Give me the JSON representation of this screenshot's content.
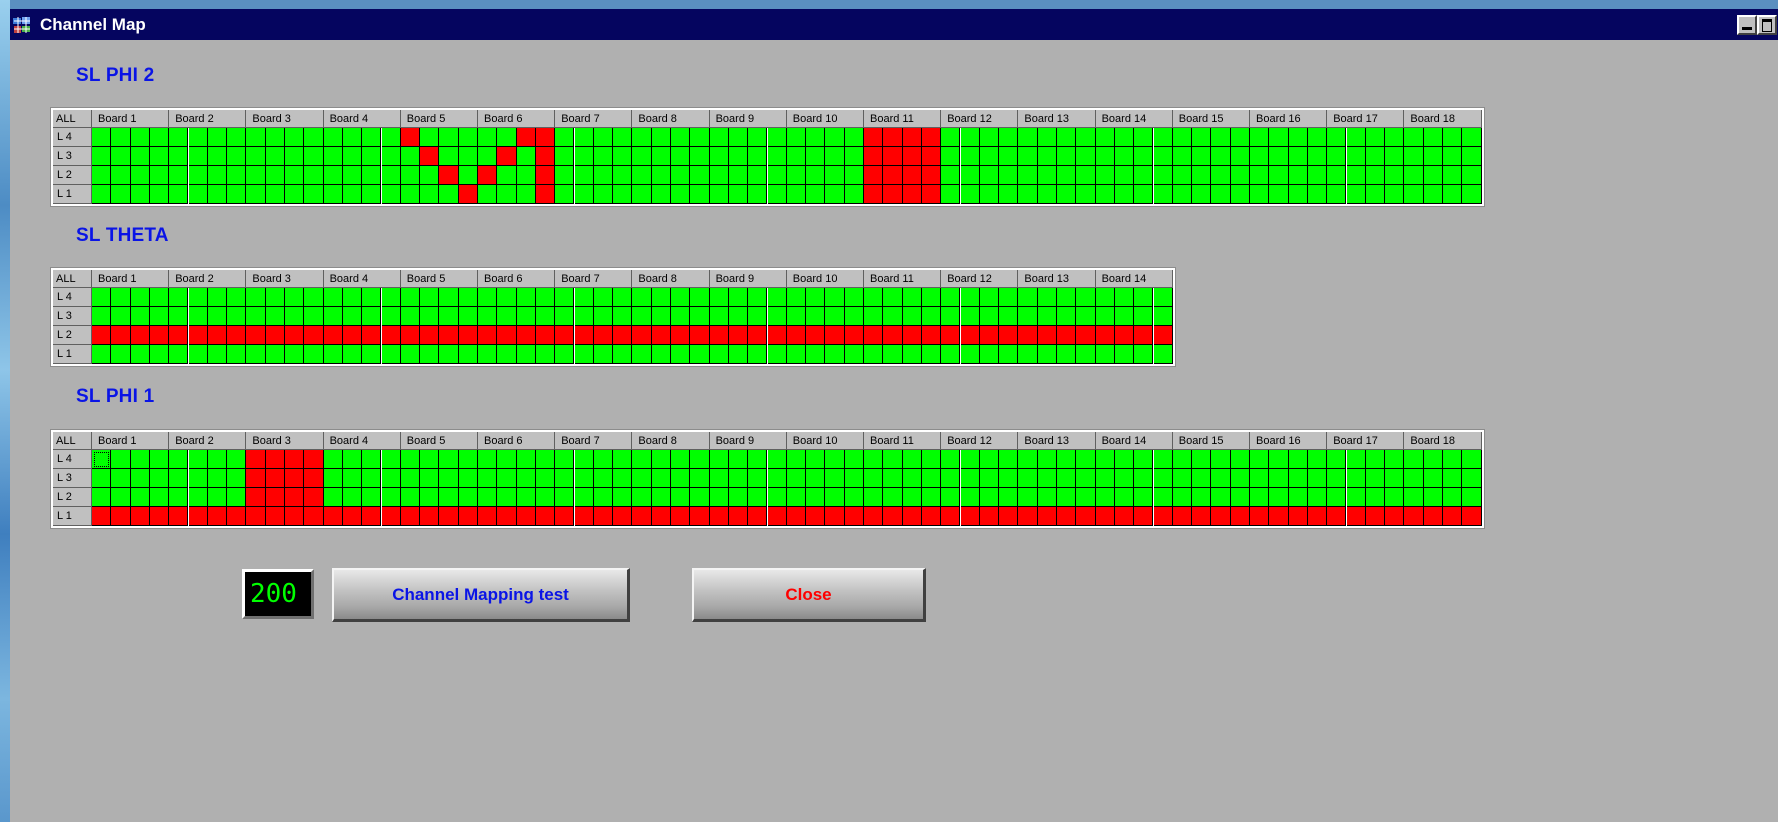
{
  "window": {
    "title": "Channel Map"
  },
  "colors": {
    "ok": "#00ff00",
    "bad": "#ff0000",
    "title_text": "#0a14e6"
  },
  "header": {
    "all_label": "ALL"
  },
  "layers": [
    "L 4",
    "L 3",
    "L 2",
    "L 1"
  ],
  "sections": [
    {
      "id": "phi2",
      "title": "SL PHI 2",
      "boards": [
        "Board 1",
        "Board 2",
        "Board 3",
        "Board 4",
        "Board 5",
        "Board 6",
        "Board 7",
        "Board 8",
        "Board 9",
        "Board 10",
        "Board 11",
        "Board 12",
        "Board 13",
        "Board 14",
        "Board 15",
        "Board 16",
        "Board 17",
        "Board 18"
      ],
      "channels_per_board": 4,
      "dead_channels": {
        "L 4": [
          16,
          22,
          23,
          40,
          41,
          42,
          43
        ],
        "L 3": [
          17,
          21,
          23,
          40,
          41,
          42,
          43
        ],
        "L 2": [
          18,
          20,
          23,
          40,
          41,
          42,
          43
        ],
        "L 1": [
          19,
          23,
          40,
          41,
          42,
          43
        ]
      },
      "dead_layers": []
    },
    {
      "id": "theta",
      "title": "SL THETA",
      "boards": [
        "Board 1",
        "Board 2",
        "Board 3",
        "Board 4",
        "Board 5",
        "Board 6",
        "Board 7",
        "Board 8",
        "Board 9",
        "Board 10",
        "Board 11",
        "Board 12",
        "Board 13",
        "Board 14"
      ],
      "channels_per_board": 4,
      "dead_channels": {},
      "dead_layers": [
        "L 2"
      ]
    },
    {
      "id": "phi1",
      "title": "SL PHI 1",
      "boards": [
        "Board 1",
        "Board 2",
        "Board 3",
        "Board 4",
        "Board 5",
        "Board 6",
        "Board 7",
        "Board 8",
        "Board 9",
        "Board 10",
        "Board 11",
        "Board 12",
        "Board 13",
        "Board 14",
        "Board 15",
        "Board 16",
        "Board 17",
        "Board 18"
      ],
      "channels_per_board": 4,
      "dead_channels": {
        "L 4": [
          8,
          9,
          10,
          11
        ],
        "L 3": [
          8,
          9,
          10,
          11
        ],
        "L 2": [
          8,
          9,
          10,
          11
        ]
      },
      "dead_layers": [
        "L 1"
      ],
      "focused_cell": {
        "layer": "L 4",
        "channel": 0
      }
    }
  ],
  "controls": {
    "counter_value": "200",
    "test_button_label": "Channel Mapping test",
    "close_button_label": "Close"
  }
}
